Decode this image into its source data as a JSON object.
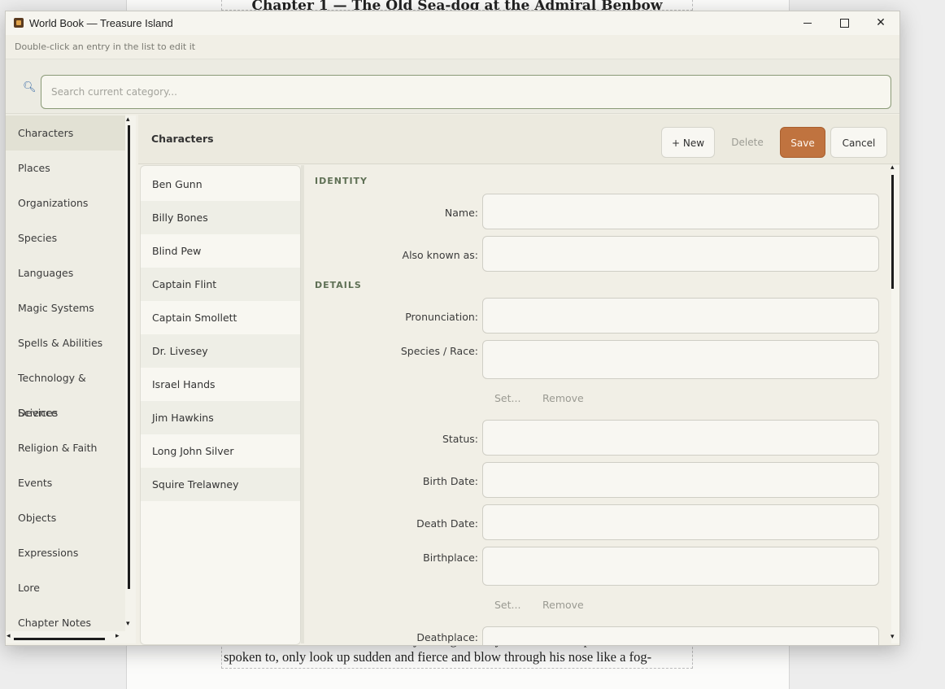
{
  "background_doc": {
    "chapter_title": "Chapter 1 — The Old Sea-dog at the Admiral Benbow",
    "line1": "he ate and drank rum and water very strong. Mostly he would not speak when",
    "line2": "spoken to, only look up sudden and fierce and blow through his nose like a fog-"
  },
  "window": {
    "title": "World Book — Treasure Island",
    "hint": "Double-click an entry in the list to edit it"
  },
  "search": {
    "placeholder": "Search current category..."
  },
  "categories": [
    "Characters",
    "Places",
    "Organizations",
    "Species",
    "Languages",
    "Magic Systems",
    "Spells & Abilities",
    "Technology & Devices",
    "Science",
    "Religion & Faith",
    "Events",
    "Objects",
    "Expressions",
    "Lore",
    "Chapter Notes"
  ],
  "active_category": "Characters",
  "panel": {
    "title": "Characters",
    "new_label": "+ New",
    "delete_label": "Delete",
    "save_label": "Save",
    "cancel_label": "Cancel"
  },
  "entries": [
    "Ben Gunn",
    "Billy Bones",
    "Blind Pew",
    "Captain Flint",
    "Captain Smollett",
    "Dr. Livesey",
    "Israel Hands",
    "Jim Hawkins",
    "Long John Silver",
    "Squire Trelawney"
  ],
  "form": {
    "identity_heading": "IDENTITY",
    "details_heading": "DETAILS",
    "name_label": "Name:",
    "aka_label": "Also known as:",
    "pronunciation_label": "Pronunciation:",
    "species_label": "Species / Race:",
    "species_set": "Set...",
    "species_remove": "Remove",
    "status_label": "Status:",
    "birth_date_label": "Birth Date:",
    "death_date_label": "Death Date:",
    "birthplace_label": "Birthplace:",
    "birthplace_set": "Set...",
    "birthplace_remove": "Remove",
    "deathplace_label": "Deathplace:"
  },
  "colors": {
    "accent": "#c0733f",
    "section": "#5f7055",
    "active_item": "#e2e1d4"
  }
}
